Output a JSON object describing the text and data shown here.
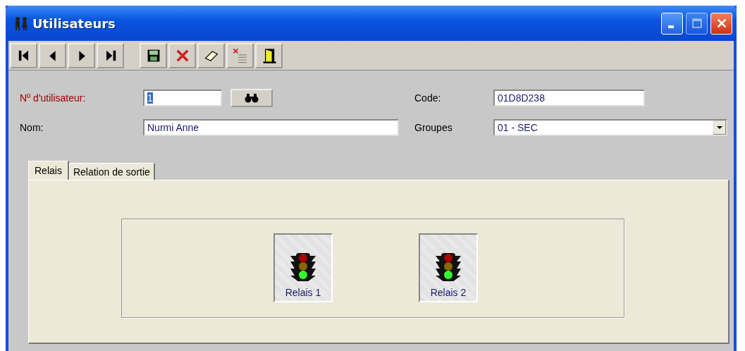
{
  "window": {
    "title": "Utilisateurs",
    "maximize_disabled": true
  },
  "toolbar": [
    {
      "kind": "first"
    },
    {
      "kind": "prev"
    },
    {
      "kind": "next"
    },
    {
      "kind": "last"
    },
    {
      "kind": "save"
    },
    {
      "kind": "delete"
    },
    {
      "kind": "erase"
    },
    {
      "kind": "clear"
    },
    {
      "kind": "exit"
    }
  ],
  "form": {
    "user_number": {
      "label": "Nº d'utilisateur:",
      "value": "1",
      "value_selected": true
    },
    "code": {
      "label": "Code:",
      "value": "01D8D238"
    },
    "name": {
      "label": "Nom:",
      "value": "Nurmi Anne"
    },
    "groups": {
      "label": "Groupes",
      "value": "01 - SEC"
    }
  },
  "tabs": [
    {
      "label": "Relais",
      "selected": true
    },
    {
      "label": "Relation de sortie",
      "selected": false
    }
  ],
  "relays": [
    {
      "label": "Relais 1"
    },
    {
      "label": "Relais 2"
    }
  ]
}
